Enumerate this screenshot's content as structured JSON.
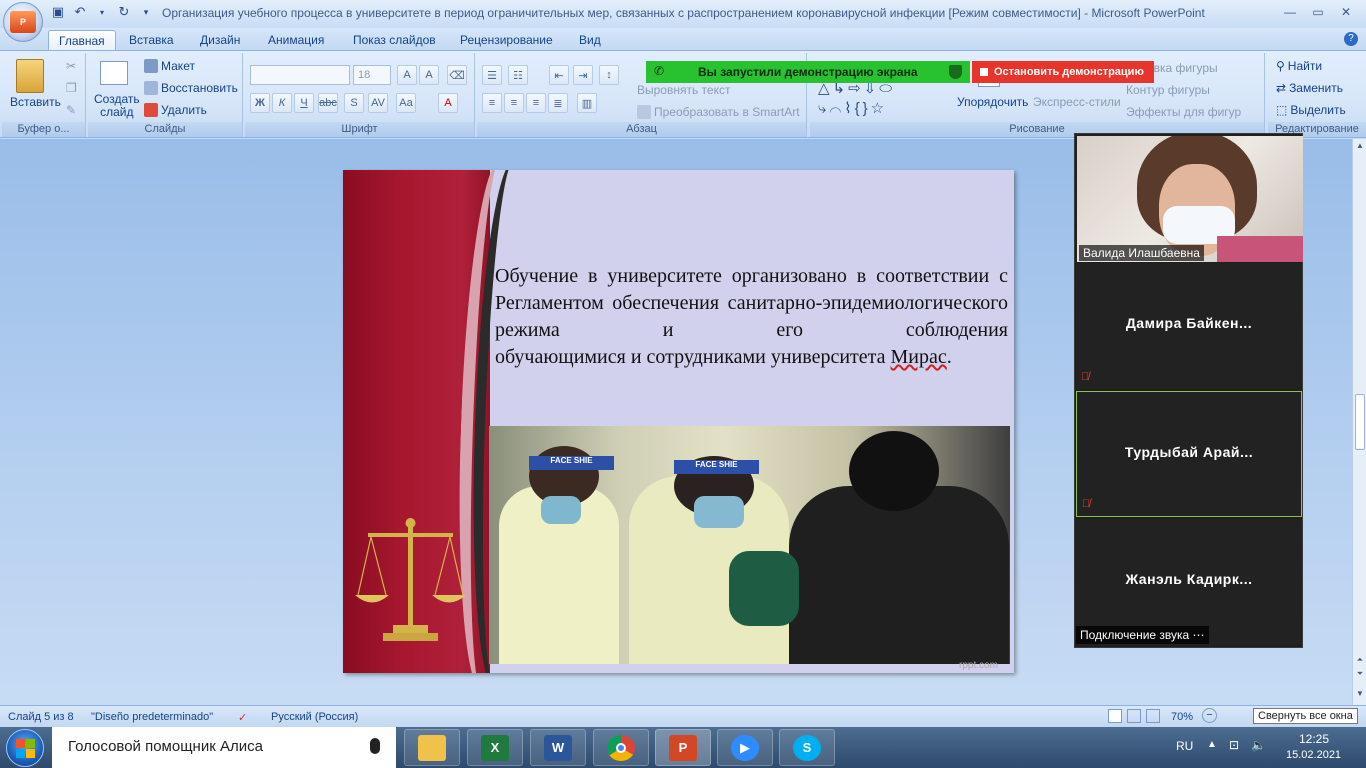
{
  "window": {
    "title": "Организация учебного процесса в университете в период ограничительных мер, связанных с распространением коронавирусной инфекции [Режим совместимости] - Microsoft PowerPoint"
  },
  "tabs": [
    "Главная",
    "Вставка",
    "Дизайн",
    "Анимация",
    "Показ слайдов",
    "Рецензирование",
    "Вид"
  ],
  "ribbon": {
    "clipboard": {
      "paste": "Вставить",
      "label": "Буфер о..."
    },
    "slides": {
      "new_slide": "Создать слайд",
      "layout": "Макет",
      "reset": "Восстановить",
      "delete": "Удалить",
      "label": "Слайды"
    },
    "font": {
      "size": "18",
      "label": "Шрифт"
    },
    "paragraph": {
      "align_text": "Выровнять текст",
      "smartart": "Преобразовать в SmartArt",
      "label": "Абзац"
    },
    "drawing": {
      "arrange": "Упорядочить",
      "quick_styles": "Экспресс-стили",
      "fill": "Заливка фигуры",
      "outline": "Контур фигуры",
      "effects": "Эффекты для фигур",
      "label": "Рисование"
    },
    "editing": {
      "find": "Найти",
      "replace": "Заменить",
      "select": "Выделить",
      "label": "Редактирование"
    }
  },
  "zoom_banner": {
    "sharing": "Вы запустили демонстрацию экрана",
    "stop": "Остановить демонстрацию"
  },
  "slide": {
    "text_main": "Обучение в университете организовано в соответствии с Регламентом обеспечения санитарно-эпидемиологического режима и его соблюдения",
    "text_end": "обучающимися и сотрудниками университета",
    "text_spell": "Мирас",
    "text_dot": ".",
    "visor1": "FACE SHIE",
    "visor2": "FACE SHIE",
    "watermark": "rppt.com"
  },
  "participants": [
    {
      "name": "Валида Илашбаевна",
      "video": true
    },
    {
      "name": "Дамира Байкен...",
      "muted": true
    },
    {
      "name": "Турдыбай Арай...",
      "muted": true,
      "active": true
    },
    {
      "name": "Жанэль Кадирк..."
    }
  ],
  "audio_link": "Подключение звука ⋯",
  "statusbar": {
    "slide_num": "Слайд 5 из 8",
    "theme": "\"Diseño predeterminado\"",
    "language": "Русский (Россия)",
    "zoom": "70%",
    "tooltip": "Свернуть все окна"
  },
  "taskbar": {
    "alice": "Голосовой помощник Алиса",
    "lang": "RU",
    "time": "12:25",
    "date": "15.02.2021"
  },
  "colors": {
    "zoom_green": "#28c231",
    "zoom_red": "#e8352b",
    "slide_red": "#a7182f"
  }
}
